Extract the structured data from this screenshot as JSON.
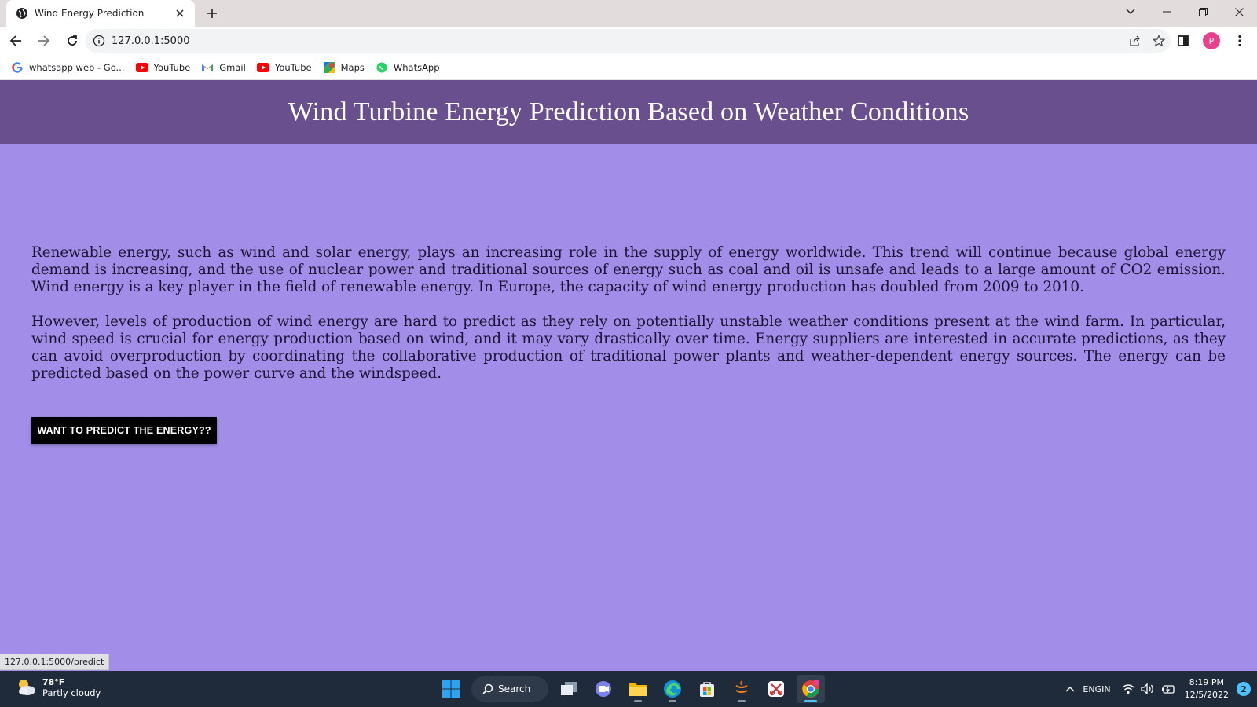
{
  "browser": {
    "tab_title": "Wind Energy Prediction",
    "url": "127.0.0.1:5000",
    "profile_initial": "P",
    "bookmarks": [
      {
        "label": "whatsapp web - Go...",
        "icon": "google-icon"
      },
      {
        "label": "YouTube",
        "icon": "youtube-icon"
      },
      {
        "label": "Gmail",
        "icon": "gmail-icon"
      },
      {
        "label": "YouTube",
        "icon": "youtube-icon"
      },
      {
        "label": "Maps",
        "icon": "maps-icon"
      },
      {
        "label": "WhatsApp",
        "icon": "whatsapp-icon"
      }
    ],
    "status_url": "127.0.0.1:5000/predict"
  },
  "page": {
    "title": "Wind Turbine Energy Prediction Based on Weather Conditions",
    "paragraphs": [
      "Renewable energy, such as wind and solar energy, plays an increasing role in the supply of energy worldwide. This trend will continue because global energy demand is increasing, and the use of nuclear power and traditional sources of energy such as coal and oil is unsafe and leads to a large amount of CO2 emission. Wind energy is a key player in the field of renewable energy. In Europe, the capacity of wind energy production has doubled from 2009 to 2010.",
      "However, levels of production of wind energy are hard to predict as they rely on potentially unstable weather conditions present at the wind farm. In particular, wind speed is crucial for energy production based on wind, and it may vary drastically over time. Energy suppliers are interested in accurate predictions, as they can avoid overproduction by coordinating the collaborative production of traditional power plants and weather-dependent energy sources. The energy can be predicted based on the power curve and the windspeed."
    ],
    "predict_button": "WANT TO PREDICT THE ENERGY??"
  },
  "taskbar": {
    "weather_temp": "78°F",
    "weather_desc": "Partly cloudy",
    "search_label": "Search",
    "lang_top": "ENG",
    "lang_bottom": "IN",
    "time": "8:19 PM",
    "date": "12/5/2022",
    "notification_count": "2"
  },
  "colors": {
    "page_background": "#a28ee8",
    "header_background": "#6a4f8f",
    "button_background": "#000000"
  }
}
